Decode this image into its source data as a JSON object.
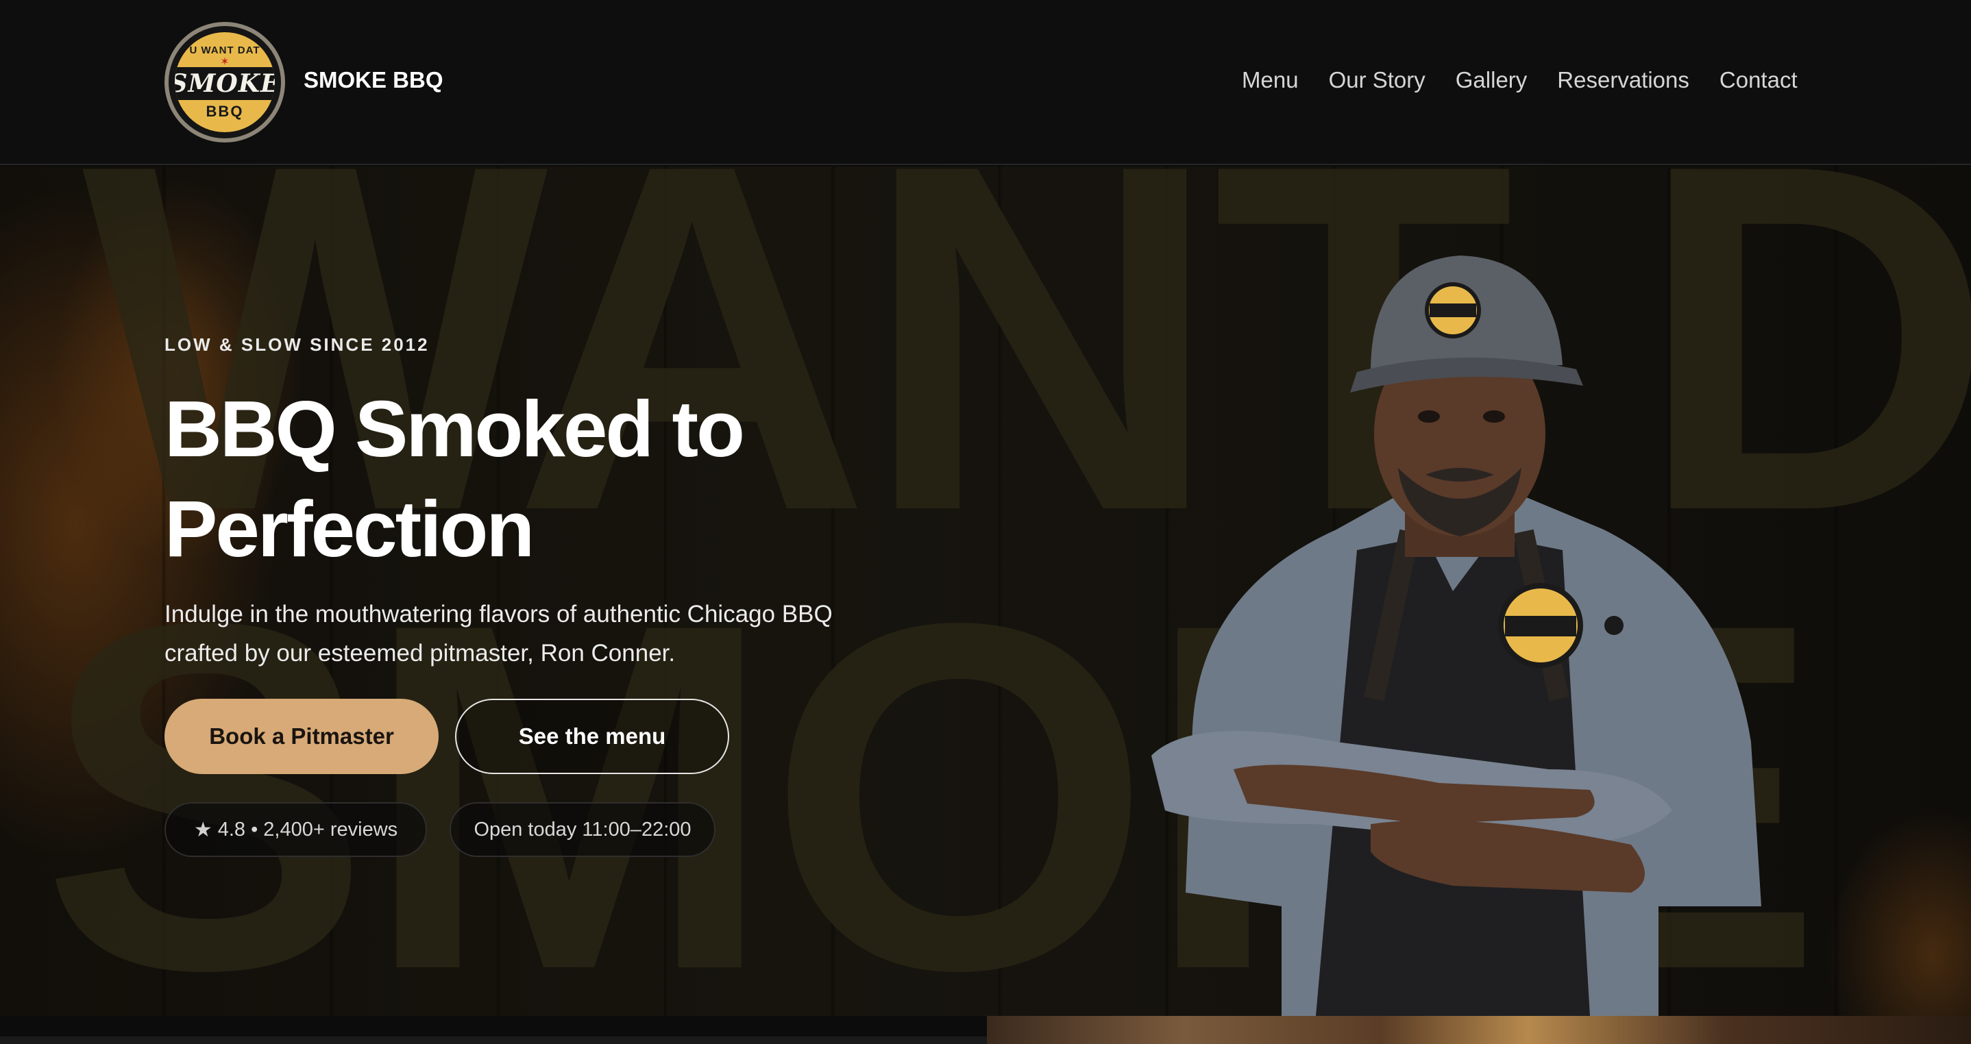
{
  "brand": {
    "name": "SMOKE BBQ",
    "logo": {
      "top_text": "U WANT DAT",
      "main_text": "SMOKE",
      "bottom_text": "BBQ"
    }
  },
  "nav": {
    "items": [
      "Menu",
      "Our Story",
      "Gallery",
      "Reservations",
      "Contact"
    ]
  },
  "hero": {
    "background_words": [
      "WANT DAT",
      "SMOKE"
    ],
    "eyebrow": "LOW & SLOW SINCE 2012",
    "title": "BBQ Smoked to Perfection",
    "subtitle": "Indulge in the mouthwatering flavors of authentic Chicago BBQ crafted by our esteemed pitmaster, Ron Conner.",
    "primary_cta": "Book a Pitmaster",
    "secondary_cta": "See the menu",
    "rating_text": "4.8 • 2,400+ reviews",
    "hours_text": "Open today 11:00–22:00",
    "rating_icon": "star-icon"
  },
  "colors": {
    "accent": "#d7aa77",
    "background": "#0e0e0e",
    "logo_gold": "#e8b94a"
  }
}
